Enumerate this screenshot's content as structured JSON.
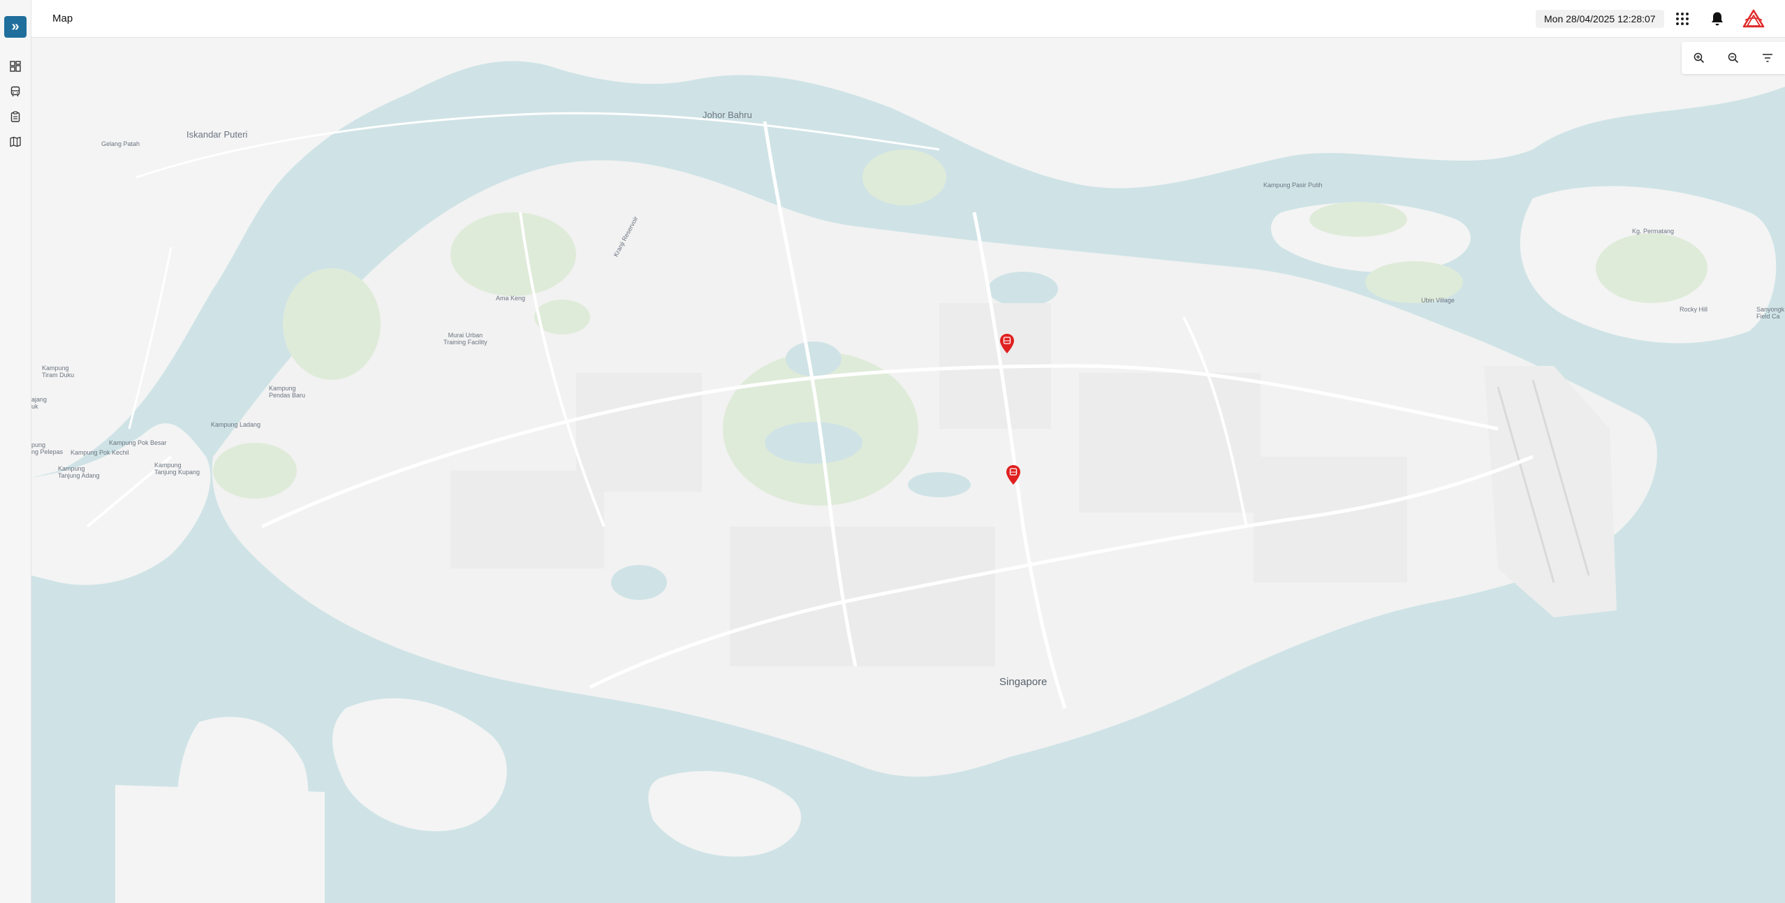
{
  "sidebar": {
    "expand_icon": "double-chevron-right-icon",
    "items": [
      {
        "name": "dashboard",
        "icon": "grid-dashboard-icon"
      },
      {
        "name": "vehicles",
        "icon": "bus-icon"
      },
      {
        "name": "reports",
        "icon": "clipboard-icon"
      },
      {
        "name": "map",
        "icon": "map-icon"
      }
    ]
  },
  "header": {
    "title": "Map",
    "datetime": "Mon 28/04/2025 12:28:07",
    "icons": [
      "apps-grid-icon",
      "bell-icon",
      "brand-logo-icon"
    ]
  },
  "map": {
    "controls": [
      "zoom-in-icon",
      "zoom-out-icon",
      "filter-icon"
    ],
    "labels": {
      "johor_bahru": "Johor Bahru",
      "iskandar_puteri": "Iskandar Puteri",
      "gelang_patah": "Gelang Patah",
      "kranji_reservoir": "Kranji Reservoir",
      "ama_keng": "Ama Keng",
      "murai_urban": "Murai Urban\nTraining Facility",
      "kampung_pasir_putih": "Kampung Pasir Putih",
      "kg_permatang": "Kg. Permatang",
      "ubin_village": "Ubin Village",
      "rocky_hill": "Rocky Hill",
      "sanyongkong": "Sanyongk\nField Ca",
      "kampung_tiram_duku": "Kampung\nTiram Duku",
      "kampung_pendas_baru": "Kampung\nPendas Baru",
      "kampung_ladang": "Kampung Ladang",
      "kampung_pok_besar": "Kampung Pok Besar",
      "kampung_pok_kechil": "Kampung Pok Kechil",
      "kampung_pelepas": "pung\nng Pelepas",
      "kampung_tanjung_adang": "Kampung\nTanjung Adang",
      "kampung_tanjung_kupang": "Kampung\nTanjung Kupang",
      "ajang": "ajang\nuk",
      "singapore": "Singapore"
    },
    "markers": [
      {
        "id": "marker-1",
        "icon": "bus-marker-icon",
        "color": "#e02020"
      },
      {
        "id": "marker-2",
        "icon": "bus-marker-icon",
        "color": "#e02020"
      }
    ]
  },
  "colors": {
    "accent": "#1f6e9c",
    "water": "#cfe3e6",
    "land": "#f4f4f4",
    "park": "#dfebd9",
    "marker": "#e02020"
  }
}
